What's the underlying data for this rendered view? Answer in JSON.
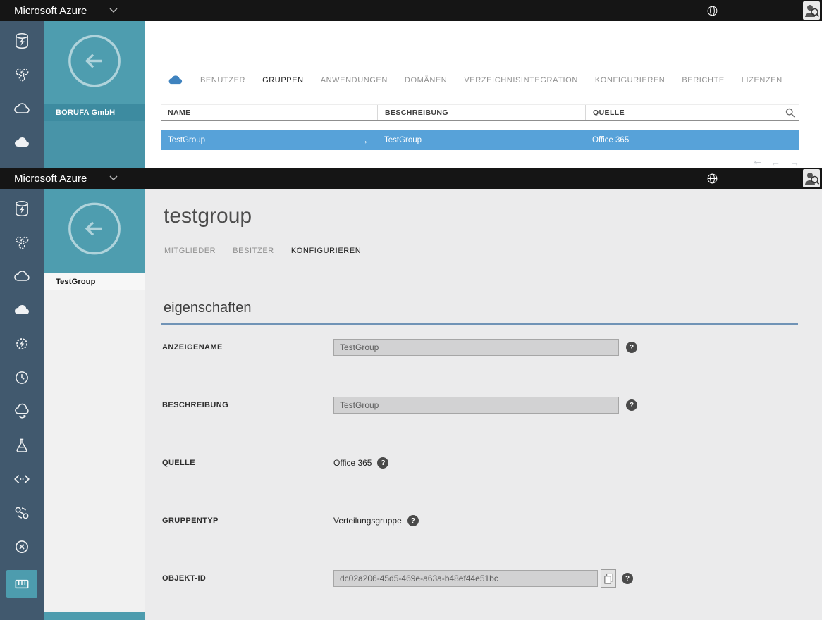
{
  "colors": {
    "titlebar": "#151515",
    "icon_strip": "#41596e",
    "teal": "#4e9daf",
    "selection_blue": "#57a2d9",
    "section_rule": "#7093b6"
  },
  "ui": {
    "help_glyph": "?",
    "row_arrow": "→",
    "pagination": {
      "first": "⇤",
      "prev": "←",
      "next": "→"
    }
  },
  "top": {
    "titlebar": {
      "title": "Microsoft Azure"
    },
    "sidebar": {
      "org": "BORUFA GmbH",
      "icons": [
        "database-lightning-icon",
        "gears-icon",
        "cloud-icon",
        "azure-cloud-icon"
      ]
    },
    "nav_tabs": [
      {
        "label": "BENUTZER",
        "active": false
      },
      {
        "label": "GRUPPEN",
        "active": true
      },
      {
        "label": "ANWENDUNGEN",
        "active": false
      },
      {
        "label": "DOMÄNEN",
        "active": false
      },
      {
        "label": "VERZEICHNISINTEGRATION",
        "active": false
      },
      {
        "label": "KONFIGURIEREN",
        "active": false
      },
      {
        "label": "BERICHTE",
        "active": false
      },
      {
        "label": "LIZENZEN",
        "active": false
      }
    ],
    "table": {
      "columns": [
        "NAME",
        "BESCHREIBUNG",
        "QUELLE"
      ],
      "rows": [
        {
          "name": "TestGroup",
          "description": "TestGroup",
          "source": "Office 365",
          "selected": true
        }
      ]
    }
  },
  "bottom": {
    "titlebar": {
      "title": "Microsoft Azure"
    },
    "sidebar": {
      "selected": "TestGroup",
      "icons": [
        "database-lightning-icon",
        "gears-icon",
        "cloud-icon",
        "azure-cloud-icon",
        "gear-lightning-icon",
        "clock-icon",
        "cloud-sync-icon",
        "flask-icon",
        "code-icon",
        "network-nodes-icon",
        "circle-x-icon",
        "keyboard-icon"
      ]
    },
    "page_title": "testgroup",
    "nav_tabs": [
      {
        "label": "MITGLIEDER",
        "active": false
      },
      {
        "label": "BESITZER",
        "active": false
      },
      {
        "label": "KONFIGURIEREN",
        "active": true
      }
    ],
    "section_title": "eigenschaften",
    "fields": [
      {
        "label": "ANZEIGENAME",
        "value": "TestGroup",
        "type": "input"
      },
      {
        "label": "BESCHREIBUNG",
        "value": "TestGroup",
        "type": "input"
      },
      {
        "label": "QUELLE",
        "value": "Office 365",
        "type": "text"
      },
      {
        "label": "GRUPPENTYP",
        "value": "Verteilungsgruppe",
        "type": "text"
      },
      {
        "label": "OBJEKT-ID",
        "value": "dc02a206-45d5-469e-a63a-b48ef44e51bc",
        "type": "input-copy"
      }
    ]
  }
}
